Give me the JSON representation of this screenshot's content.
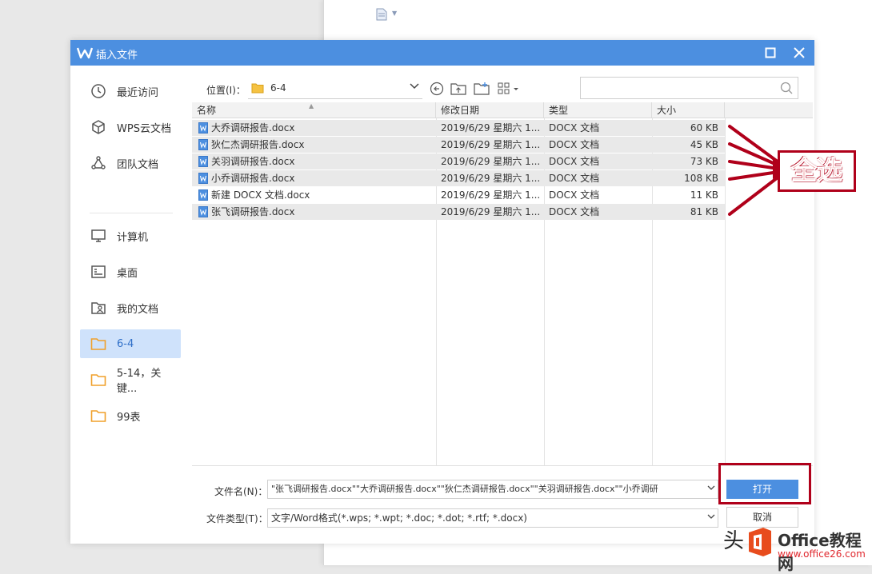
{
  "dialog": {
    "title": "插入文件",
    "colors": {
      "titlebar": "#4c8fe0",
      "selected_sidebar": "#cfe2fb",
      "annotation": "#b0001a"
    }
  },
  "sidebar": {
    "items": [
      {
        "label": "最近访问",
        "icon": "clock-icon"
      },
      {
        "label": "WPS云文档",
        "icon": "cube-icon"
      },
      {
        "label": "团队文档",
        "icon": "team-icon"
      },
      {
        "label": "计算机",
        "icon": "monitor-icon"
      },
      {
        "label": "桌面",
        "icon": "desktop-icon"
      },
      {
        "label": "我的文档",
        "icon": "user-folder-icon"
      },
      {
        "label": "6-4",
        "icon": "folder-icon",
        "selected": true
      },
      {
        "label": "5-14，关键...",
        "icon": "folder-icon"
      },
      {
        "label": "99表",
        "icon": "folder-icon"
      }
    ]
  },
  "location": {
    "label": "位置(I)：",
    "value": "6-4"
  },
  "search": {
    "placeholder": ""
  },
  "columns": [
    "名称",
    "修改日期",
    "类型",
    "大小"
  ],
  "files": [
    {
      "name": "大乔调研报告.docx",
      "date": "2019/6/29 星期六 1...",
      "type": "DOCX 文档",
      "size": "60 KB",
      "selected": true
    },
    {
      "name": "狄仁杰调研报告.docx",
      "date": "2019/6/29 星期六 1...",
      "type": "DOCX 文档",
      "size": "45 KB",
      "selected": true
    },
    {
      "name": "关羽调研报告.docx",
      "date": "2019/6/29 星期六 1...",
      "type": "DOCX 文档",
      "size": "73 KB",
      "selected": true
    },
    {
      "name": "小乔调研报告.docx",
      "date": "2019/6/29 星期六 1...",
      "type": "DOCX 文档",
      "size": "108 KB",
      "selected": true
    },
    {
      "name": "新建 DOCX 文档.docx",
      "date": "2019/6/29 星期六 1...",
      "type": "DOCX 文档",
      "size": "11 KB",
      "selected": false
    },
    {
      "name": "张飞调研报告.docx",
      "date": "2019/6/29 星期六 1...",
      "type": "DOCX 文档",
      "size": "81 KB",
      "selected": true
    }
  ],
  "filename": {
    "label": "文件名(N)：",
    "value": "\"张飞调研报告.docx\"\"大乔调研报告.docx\"\"狄仁杰调研报告.docx\"\"关羽调研报告.docx\"\"小乔调研"
  },
  "filetype": {
    "label": "文件类型(T)：",
    "value": "文字/Word格式(*.wps; *.wpt; *.doc; *.dot; *.rtf; *.docx)"
  },
  "buttons": {
    "open": "打开",
    "cancel": "取消"
  },
  "annotation": {
    "text": "全选"
  },
  "watermark": {
    "head": "头",
    "site_title": "Office教程网",
    "url": "www.office26.com"
  }
}
